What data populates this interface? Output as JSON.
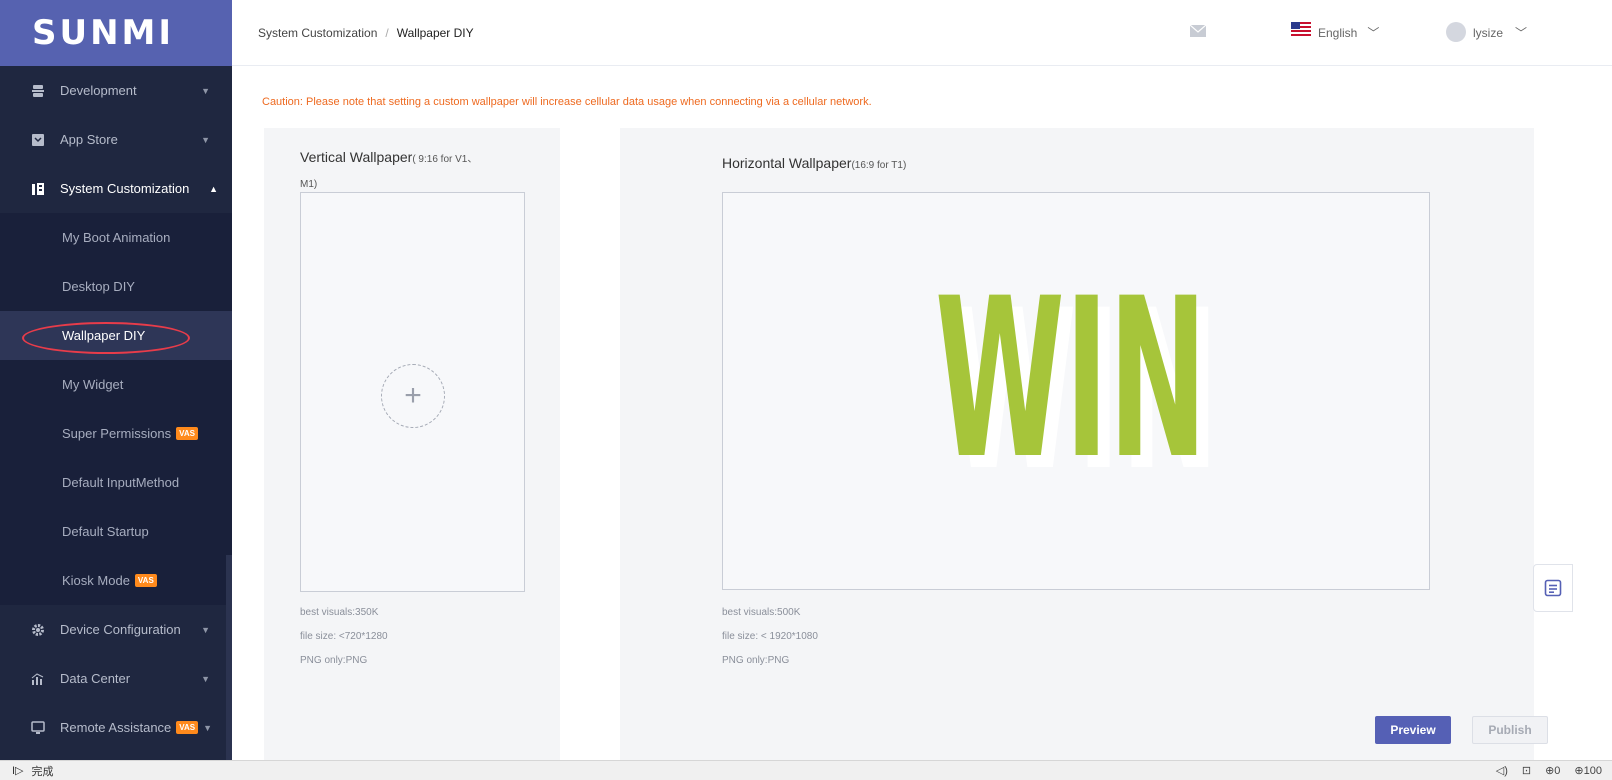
{
  "brand": {
    "logo": "SUNMI"
  },
  "sidebar": {
    "items": [
      {
        "label": "Development",
        "icon": "development-icon"
      },
      {
        "label": "App Store",
        "icon": "app-store-icon"
      },
      {
        "label": "System Customization",
        "icon": "system-customization-icon",
        "open": true
      }
    ],
    "subitems": [
      {
        "label": "My Boot Animation"
      },
      {
        "label": "Desktop DIY"
      },
      {
        "label": "Wallpaper DIY",
        "active": true
      },
      {
        "label": "My Widget"
      },
      {
        "label": "Super Permissions",
        "badge": "VAS"
      },
      {
        "label": "Default InputMethod"
      },
      {
        "label": "Default Startup"
      },
      {
        "label": "Kiosk Mode",
        "badge": "VAS"
      }
    ],
    "bottom_items": [
      {
        "label": "Device Configuration",
        "icon": "gear-icon"
      },
      {
        "label": "Data Center",
        "icon": "chart-icon"
      },
      {
        "label": "Remote Assistance",
        "icon": "monitor-icon",
        "badge": "VAS"
      }
    ]
  },
  "header": {
    "breadcrumb": [
      "System Customization",
      "/",
      "Wallpaper DIY"
    ],
    "language": "English",
    "user": "lysize"
  },
  "main": {
    "caution": "Caution: Please note that setting a custom wallpaper will increase cellular data usage when connecting via a cellular network.",
    "vertical": {
      "title": "Vertical Wallpaper",
      "note": "( 9:16 for V1、",
      "note2": "M1)",
      "best_visuals": "best visuals:350K",
      "file_size": "file size: <720*1280",
      "png_only": "PNG only:PNG"
    },
    "horizontal": {
      "title": "Horizontal Wallpaper",
      "note": "(16:9 for T1)",
      "image_text": "WIN",
      "best_visuals": "best visuals:500K",
      "file_size": "file size: < 1920*1080",
      "png_only": "PNG only:PNG"
    },
    "buttons": {
      "preview": "Preview",
      "publish": "Publish"
    }
  },
  "statusbar": {
    "left_icon": "I▷",
    "status": "完成",
    "zoom": "100"
  },
  "colors": {
    "sidebar": "#1f2740",
    "logo_bg": "#5662b0",
    "accent": "#5560b5",
    "caution": "#ee6a20",
    "badge": "#ff8a1c",
    "win": "#a6c53a"
  }
}
